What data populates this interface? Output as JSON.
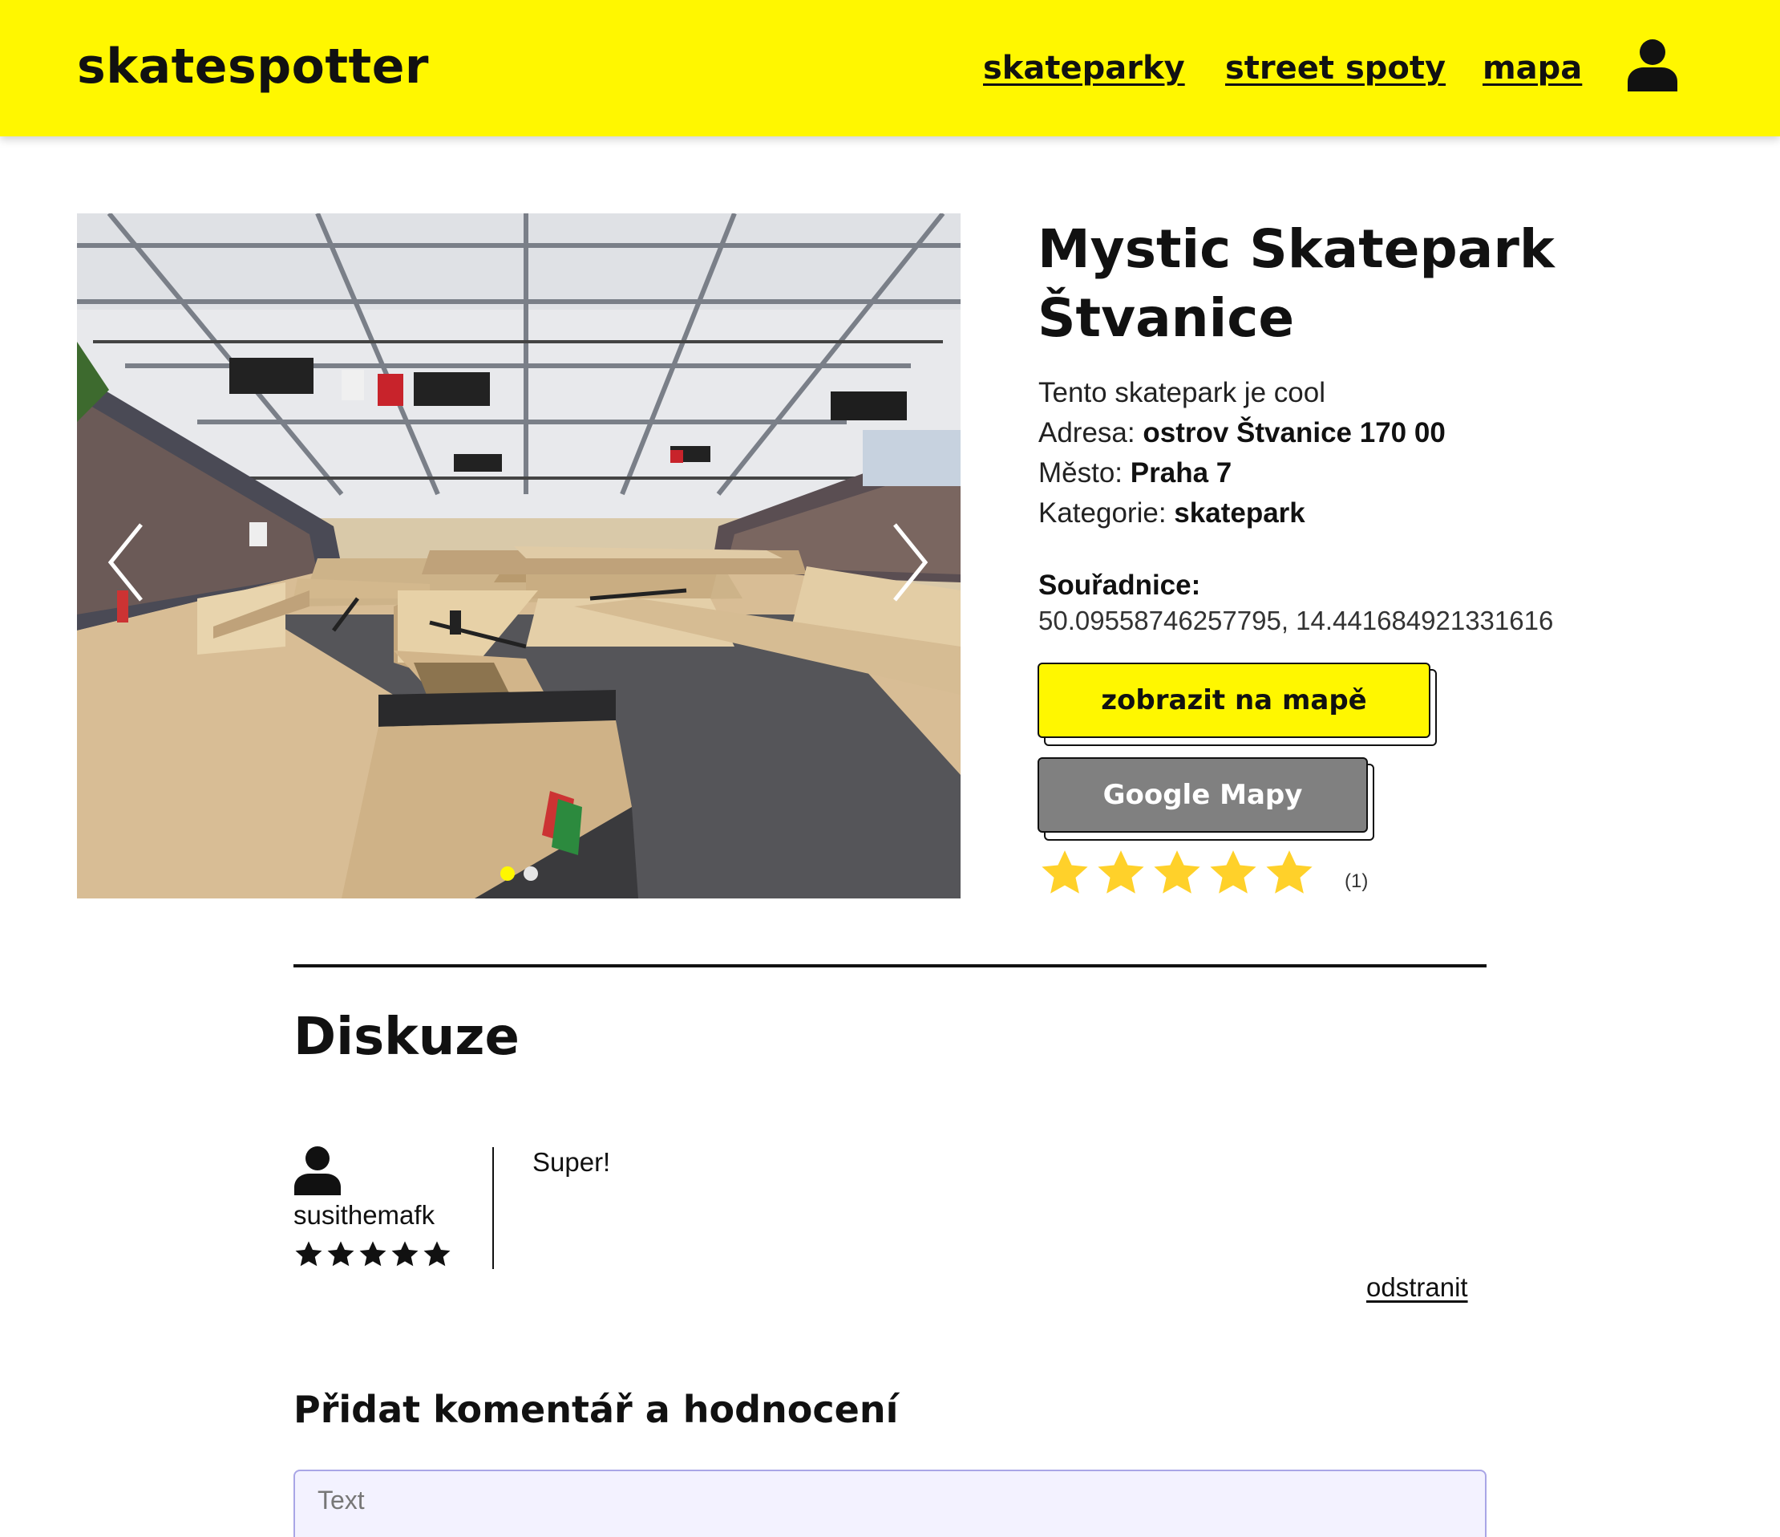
{
  "header": {
    "brand": "skatespotter",
    "nav": [
      {
        "label": "skateparky"
      },
      {
        "label": "street spoty"
      },
      {
        "label": "mapa"
      }
    ],
    "user_icon": "user-icon"
  },
  "carousel": {
    "slide_count": 2,
    "active_index": 0,
    "active_dot_color": "#fff700",
    "inactive_dot_color": "#e5e5e5"
  },
  "spot": {
    "title_line1": "Mystic Skatepark",
    "title_line2": "Štvanice",
    "description": "Tento skatepark je cool",
    "address_label": "Adresa:",
    "address_value": "ostrov Štvanice 170 00",
    "city_label": "Město:",
    "city_value": "Praha 7",
    "category_label": "Kategorie:",
    "category_value": "skatepark",
    "coords_label": "Souřadnice:",
    "coords_value": "50.09558746257795, 14.441684921331616",
    "btn_map": "zobrazit na mapě",
    "btn_google": "Google Mapy",
    "rating_stars": 5,
    "rating_count": "(1)",
    "star_color": "#ffd12a"
  },
  "discussion": {
    "title": "Diskuze",
    "comments": [
      {
        "username": "susithemafk",
        "stars": 5,
        "text": "Super!",
        "remove_label": "odstranit"
      }
    ],
    "add_title": "Přidat komentář a hodnocení",
    "input_placeholder": "Text"
  },
  "colors": {
    "brand_yellow": "#fff700",
    "google_button": "#808080"
  }
}
